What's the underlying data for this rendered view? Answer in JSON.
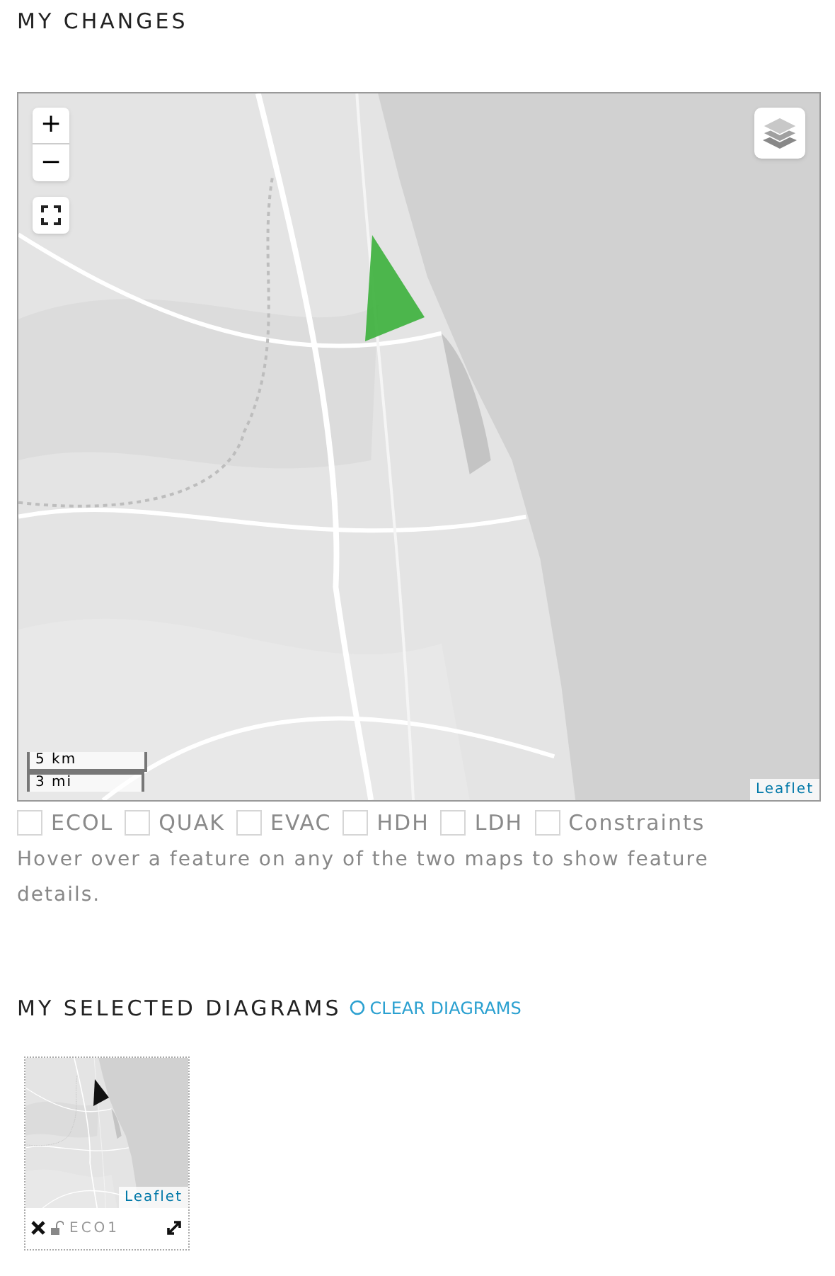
{
  "changes": {
    "title": "MY CHANGES",
    "map": {
      "zoom_in": "+",
      "zoom_out": "−",
      "scale": [
        "5 km",
        "3 mi"
      ],
      "attribution": "Leaflet"
    },
    "layers": [
      {
        "label": "ECOL",
        "checked": false
      },
      {
        "label": "QUAK",
        "checked": false
      },
      {
        "label": "EVAC",
        "checked": false
      },
      {
        "label": "HDH",
        "checked": false
      },
      {
        "label": "LDH",
        "checked": false
      },
      {
        "label": "Constraints",
        "checked": false
      }
    ],
    "hint": "Hover over a feature on any of the two maps to show feature details."
  },
  "diagrams": {
    "title": "MY SELECTED DIAGRAMS",
    "clear": "CLEAR DIAGRAMS",
    "items": [
      {
        "name": "ECO1",
        "attribution": "Leaflet",
        "locked": false
      }
    ]
  }
}
